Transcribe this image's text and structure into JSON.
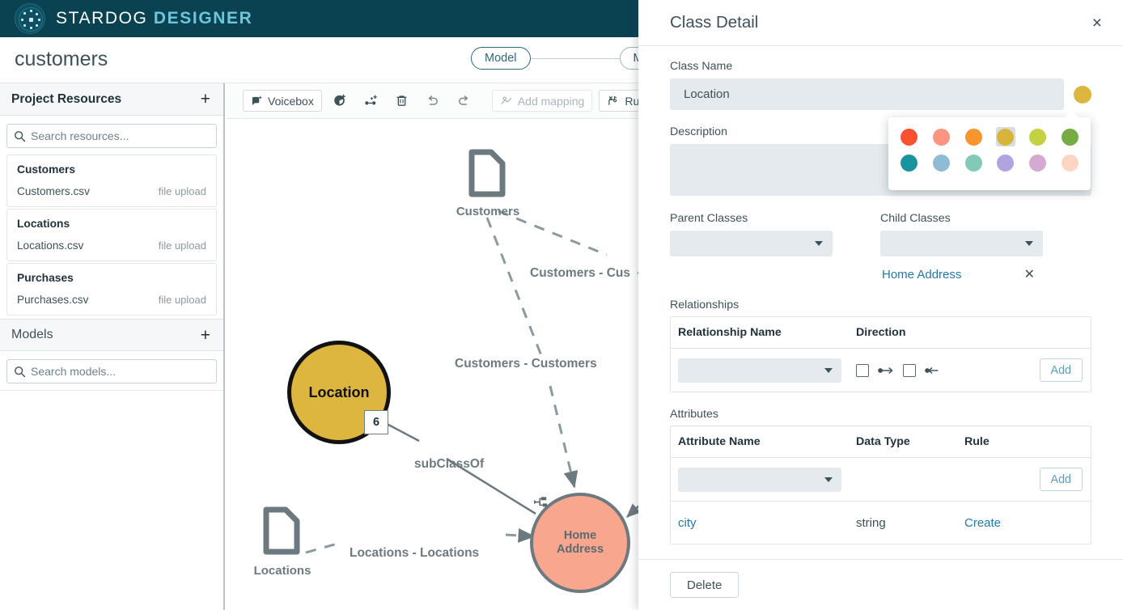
{
  "app": {
    "brand_primary": "STARDOG",
    "brand_secondary": "DESIGNER",
    "logo_icon": "stardog-graph-logo-icon"
  },
  "project": {
    "title": "customers"
  },
  "flow": {
    "model_tab": "Model",
    "mapping_tab": "Mapping"
  },
  "sidebar": {
    "resources": {
      "title": "Project Resources",
      "add_label": "+",
      "search_placeholder": "Search resources...",
      "items": [
        {
          "name": "Customers",
          "file": "Customers.csv",
          "source": "file upload"
        },
        {
          "name": "Locations",
          "file": "Locations.csv",
          "source": "file upload"
        },
        {
          "name": "Purchases",
          "file": "Purchases.csv",
          "source": "file upload"
        }
      ]
    },
    "models": {
      "title": "Models",
      "add_label": "+",
      "search_placeholder": "Search models..."
    }
  },
  "toolbar": {
    "voicebox_label": "Voicebox",
    "add_mapping_label": "Add mapping",
    "rules_label": "Rules",
    "icons": [
      "add-class-icon",
      "add-relationship-icon",
      "trash-icon",
      "undo-icon",
      "redo-icon"
    ]
  },
  "graph": {
    "nodes": [
      {
        "id": "location",
        "label": "Location",
        "type": "class",
        "color": "#ddb63f",
        "badge": "6"
      },
      {
        "id": "home_address",
        "label": "Home\nAddress",
        "label_line1": "Home",
        "label_line2": "Address",
        "type": "class",
        "color": "#f9a68e"
      },
      {
        "id": "customers_doc",
        "label": "Customers",
        "type": "data-source"
      },
      {
        "id": "locations_doc",
        "label": "Locations",
        "type": "data-source"
      }
    ],
    "edges": [
      {
        "label": "Customers - Cus",
        "style": "dashed"
      },
      {
        "label": "Customers - Customers",
        "style": "dashed"
      },
      {
        "label": "subClassOf",
        "style": "solid"
      },
      {
        "label": "Locations - Locations",
        "style": "dashed"
      }
    ]
  },
  "detail": {
    "title": "Class Detail",
    "close_label": "×",
    "class_name_label": "Class Name",
    "class_name_value": "Location",
    "class_color": "#ddb63f",
    "description_label": "Description",
    "description_value": "",
    "parent_classes_label": "Parent Classes",
    "parent_classes_value": "",
    "child_classes_label": "Child Classes",
    "child_classes_value": "",
    "child_chip": "Home Address",
    "child_chip_remove": "✕",
    "relationships_label": "Relationships",
    "rel_col_name": "Relationship Name",
    "rel_col_direction": "Direction",
    "rel_add_label": "Add",
    "attributes_label": "Attributes",
    "attr_col_name": "Attribute Name",
    "attr_col_type": "Data Type",
    "attr_col_rule": "Rule",
    "attr_add_label": "Add",
    "attribute_rows": [
      {
        "name": "city",
        "type": "string",
        "rule": "Create"
      }
    ],
    "delete_label": "Delete",
    "color_palette": {
      "row1": [
        "#fb5130",
        "#fd9580",
        "#f8952e",
        "#d9b43c",
        "#c3d240",
        "#77ab44"
      ],
      "row2": [
        "#18949f",
        "#8fbcd4",
        "#82c9b6",
        "#b0a3e0",
        "#d5aad0",
        "#fcd6c3"
      ],
      "selected": "#d9b43c"
    }
  }
}
